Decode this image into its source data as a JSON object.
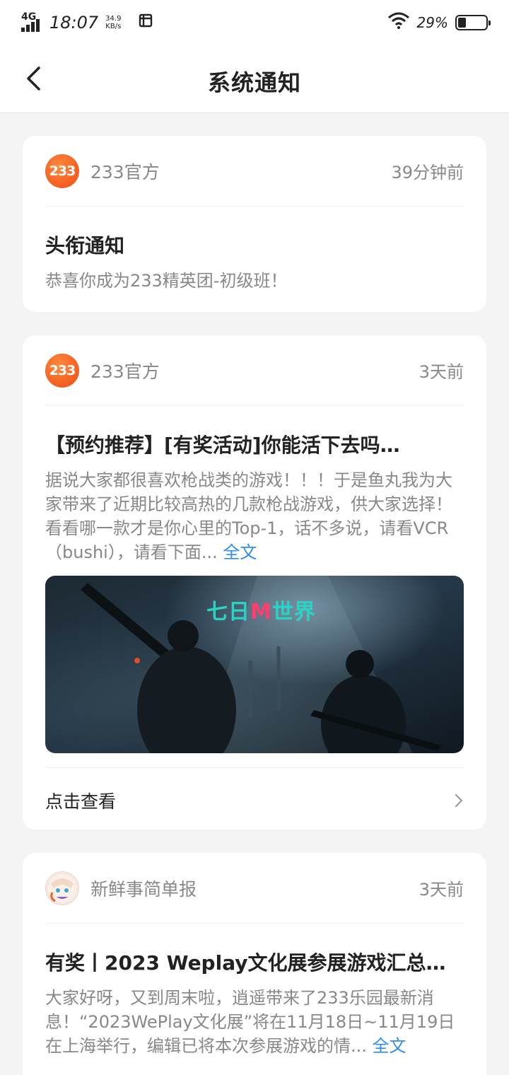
{
  "status_bar": {
    "network": "4G",
    "time": "18:07",
    "speed_value": "34.9",
    "speed_unit": "KB/s",
    "battery": "29%"
  },
  "header": {
    "title": "系统通知"
  },
  "notifications": [
    {
      "sender": "233官方",
      "avatar_text": "233",
      "time": "39分钟前",
      "title": "头衔通知",
      "body": "恭喜你成为233精英团-初级班！"
    },
    {
      "sender": "233官方",
      "avatar_text": "233",
      "time": "3天前",
      "title": "【预约推荐】[有奖活动]你能活下去吗…",
      "body": "据说大家都很喜欢枪战类的游戏！！！于是鱼丸我为大家带来了近期比较高热的几款枪战游戏，供大家选择！看看哪一款才是你心里的Top-1，话不多说，请看VCR（bushi），请看下面...",
      "more_label": "全文",
      "image_logo_left": "七日",
      "image_logo_mid": "M",
      "image_logo_right": "世界",
      "footer_label": "点击查看"
    },
    {
      "sender": "新鲜事简单报",
      "time": "3天前",
      "title": "有奖丨2023 Weplay文化展参展游戏汇总…",
      "body": "大家好呀，又到周末啦，逍遥带来了233乐园最新消息！“2023WePlay文化展”将在11月18日~11月19日在上海举行，编辑已将本次参展游戏的情...",
      "more_label": "全文"
    }
  ],
  "colors": {
    "accent_link": "#2f8df0",
    "brand_orange": "#f04a14",
    "logo_teal": "#2bd3c4"
  }
}
